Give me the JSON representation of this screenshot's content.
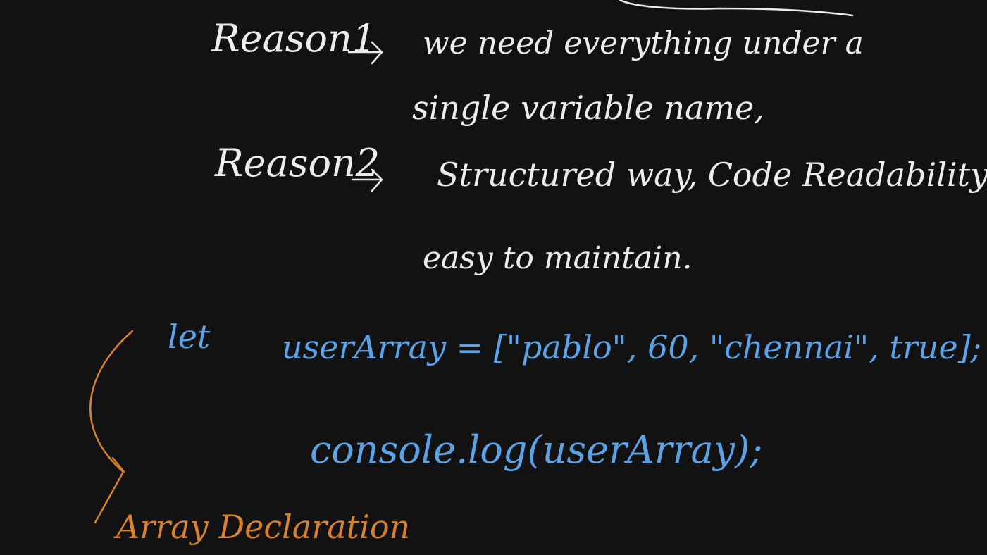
{
  "whiteboard": {
    "background_color": "#121212",
    "ink_colors": {
      "white": "#ececec",
      "blue": "#5ba3e8",
      "orange": "#d9822b"
    },
    "notes": {
      "reason1_label": "Reason1",
      "reason1_line1": "we need everything under a",
      "reason1_line2": "single variable name,",
      "reason2_label": "Reason2",
      "reason2_line1": "Structured way, Code Readability",
      "reason2_line2": "easy to maintain."
    },
    "code": {
      "line1_keyword": "let",
      "line1_statement": "userArray = [\"pablo\", 60, \"chennai\", true];",
      "line2": "console.log(userArray);"
    },
    "annotation": {
      "label": "Array Declaration"
    }
  }
}
